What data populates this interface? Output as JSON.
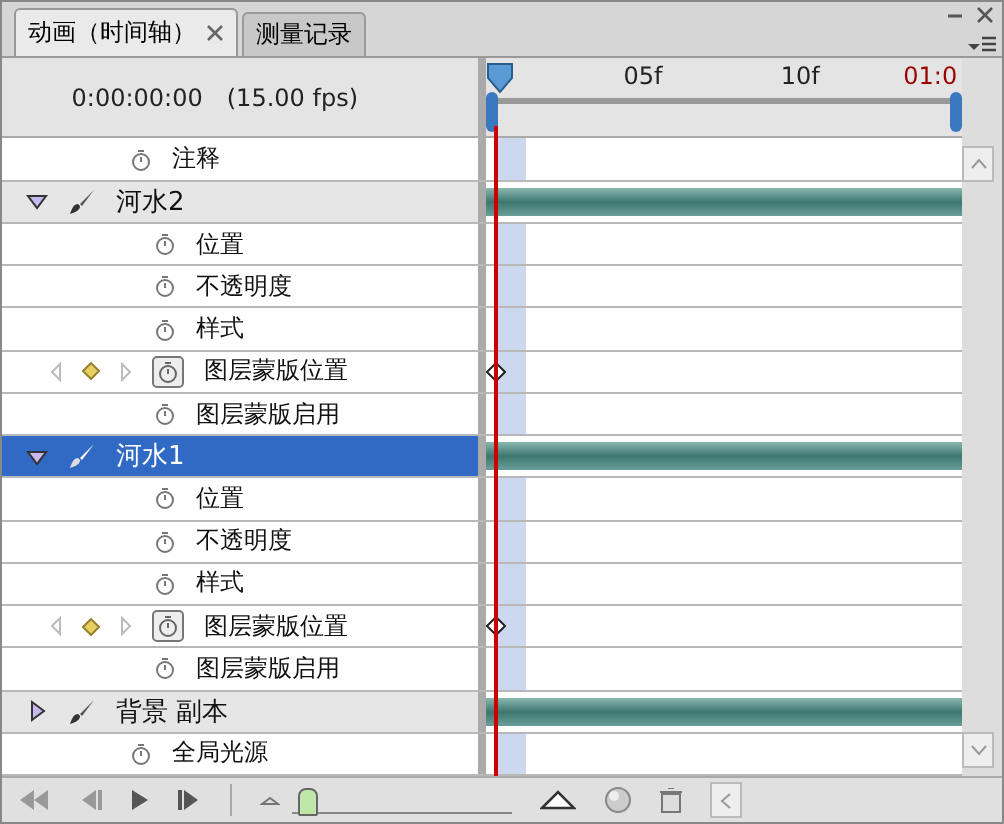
{
  "tabs": [
    {
      "label": "动画（时间轴）",
      "selected": true,
      "closable": true
    },
    {
      "label": "测量记录",
      "selected": false,
      "closable": false
    }
  ],
  "time": "0:00:00:00",
  "fps": "(15.00 fps)",
  "ruler": [
    {
      "label": "05f",
      "kind": "frame"
    },
    {
      "label": "10f",
      "kind": "frame"
    },
    {
      "label": "01:0",
      "kind": "end"
    }
  ],
  "rows": [
    {
      "kind": "global",
      "name": "注释"
    },
    {
      "kind": "layer",
      "name": "河水2",
      "expanded": true,
      "selected": false
    },
    {
      "kind": "property",
      "name": "位置"
    },
    {
      "kind": "property",
      "name": "不透明度"
    },
    {
      "kind": "property",
      "name": "样式"
    },
    {
      "kind": "keyed",
      "name": "图层蒙版位置"
    },
    {
      "kind": "property",
      "name": "图层蒙版启用"
    },
    {
      "kind": "layer",
      "name": "河水1",
      "expanded": true,
      "selected": true
    },
    {
      "kind": "property",
      "name": "位置"
    },
    {
      "kind": "property",
      "name": "不透明度"
    },
    {
      "kind": "property",
      "name": "样式"
    },
    {
      "kind": "keyed",
      "name": "图层蒙版位置"
    },
    {
      "kind": "property",
      "name": "图层蒙版启用"
    },
    {
      "kind": "layer",
      "name": "背景 副本",
      "expanded": false,
      "selected": false
    },
    {
      "kind": "global",
      "name": "全局光源"
    }
  ],
  "zoom": {
    "level": 0.03
  }
}
